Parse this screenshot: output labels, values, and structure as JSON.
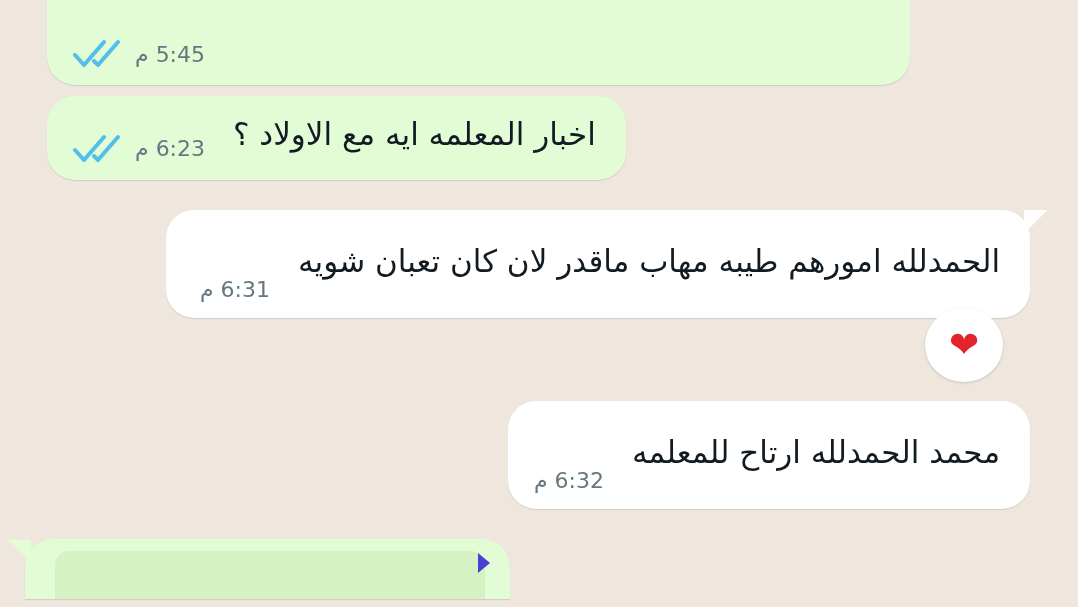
{
  "messages": [
    {
      "outgoing": true,
      "tail": false,
      "time": "5:45 م",
      "read": true
    },
    {
      "outgoing": true,
      "tail": false,
      "text": "اخبار المعلمه ايه مع الاولاد ؟",
      "time": "6:23 م",
      "read": true
    },
    {
      "outgoing": false,
      "tail": true,
      "text": "الحمدلله امورهم طيبه مهاب ماقدر لان كان تعبان شويه",
      "time": "6:31 م",
      "reaction": "❤"
    },
    {
      "outgoing": false,
      "tail": false,
      "text": "محمد الحمدلله ارتاح للمعلمه",
      "time": "6:32 م"
    },
    {
      "outgoing": true,
      "tail": true,
      "quoted": true
    }
  ]
}
